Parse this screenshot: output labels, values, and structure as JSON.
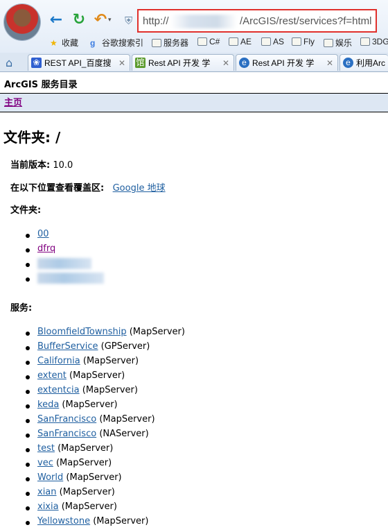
{
  "browser": {
    "address": {
      "prefix": "http://",
      "path": "/ArcGIS/rest/services?f=html"
    },
    "favorites": [
      {
        "label": "收藏",
        "icon": "star-icon"
      },
      {
        "label": "谷歌搜索引",
        "icon": "google-icon"
      },
      {
        "label": "服务器",
        "icon": "folder-icon"
      },
      {
        "label": "C#",
        "icon": "folder-icon"
      },
      {
        "label": "AE",
        "icon": "folder-icon"
      },
      {
        "label": "AS",
        "icon": "folder-icon"
      },
      {
        "label": "Fly",
        "icon": "folder-icon"
      },
      {
        "label": "娱乐",
        "icon": "folder-icon"
      },
      {
        "label": "3DG",
        "icon": "folder-icon"
      }
    ],
    "tabs": [
      {
        "label": "REST API_百度搜",
        "icon": "baidu-paw-icon"
      },
      {
        "label": "Rest API 开发 学",
        "icon": "blog-icon"
      },
      {
        "label": "Rest API 开发 学",
        "icon": "ie-icon"
      },
      {
        "label": "利用Arc",
        "icon": "ie-icon"
      }
    ]
  },
  "page": {
    "header": "ArcGIS 服务目录",
    "breadcrumb_home": "主页",
    "folder_title": "文件夹: /",
    "version_label": "当前版本:",
    "version_value": "10.0",
    "coverage_label": "在以下位置查看覆盖区:",
    "coverage_link": "Google 地球",
    "folders_label": "文件夹:",
    "folders": [
      "00",
      "dfrq"
    ],
    "services_label": "服务:",
    "services": [
      {
        "name": "BloomfieldTownship",
        "type": "(MapServer)"
      },
      {
        "name": "BufferService",
        "type": "(GPServer)"
      },
      {
        "name": "California",
        "type": "(MapServer)"
      },
      {
        "name": "extent",
        "type": "(MapServer)"
      },
      {
        "name": "extentcia",
        "type": "(MapServer)"
      },
      {
        "name": "keda",
        "type": "(MapServer)"
      },
      {
        "name": "SanFrancisco",
        "type": "(MapServer)"
      },
      {
        "name": "SanFrancisco",
        "type": "(NAServer)"
      },
      {
        "name": "test",
        "type": "(MapServer)"
      },
      {
        "name": "vec",
        "type": "(MapServer)"
      },
      {
        "name": "World",
        "type": "(MapServer)"
      },
      {
        "name": "xian",
        "type": "(MapServer)"
      },
      {
        "name": "xixia",
        "type": "(MapServer)"
      },
      {
        "name": "Yellowstone",
        "type": "(MapServer)"
      }
    ]
  },
  "colors": {
    "link": "#1f5fa0",
    "visited_link": "#800080",
    "highlight_border": "#e0302c",
    "crumb_bg": "#dde7f3"
  }
}
